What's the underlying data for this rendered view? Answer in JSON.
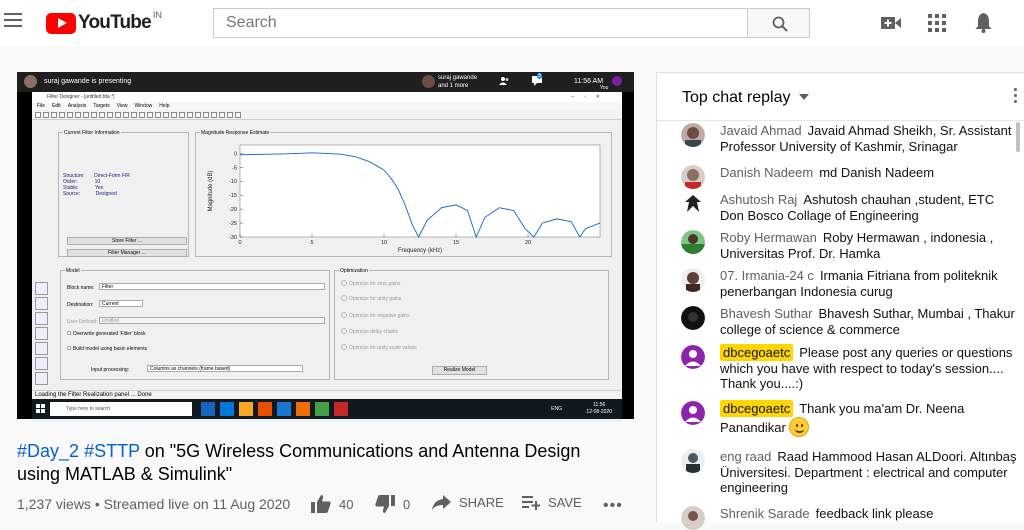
{
  "header": {
    "logo_text": "YouTube",
    "country": "IN",
    "search_placeholder": "Search"
  },
  "player": {
    "presenter_text": "suraj gawande is presenting",
    "participants_line1": "suraj gawande",
    "participants_line2": "and 1 more",
    "participant_count": "3",
    "meet_time": "11:56 AM",
    "you_label": "You",
    "app": {
      "window_title": "Filter Designer - [untitled.fda *]",
      "menu": [
        "File",
        "Edit",
        "Analysis",
        "Targets",
        "View",
        "Window",
        "Help"
      ],
      "current_filter_label": "Current Filter Information",
      "structure_label": "Structure:",
      "structure_value": "Direct-Form FIR",
      "order_label": "Order:",
      "order_value": "10",
      "stable_label": "Stable:",
      "stable_value": "Yes",
      "source_label": "Source:",
      "source_value": "Designed",
      "store_filter": "Store Filter ...",
      "filter_manager": "Filter Manager ...",
      "magnitude_panel_label": "Magnitude Response Estimate",
      "plot_ylabel": "Magnitude (dB)",
      "plot_xlabel": "Frequency (kHz)",
      "model_label": "Model",
      "block_name_label": "Block name:",
      "block_name_value": "Filter",
      "destination_label": "Destination:",
      "destination_value": "Current",
      "user_defined_label": "User Defined:",
      "user_defined_value": "Untitled",
      "overwrite_label": "Overwrite generated 'Filter' block",
      "build_model_label": "Build model using basic elements",
      "input_processing_label": "Input processing:",
      "input_processing_value": "Columns as channels (frame based)",
      "optimization_label": "Optimization",
      "opt1": "Optimize for zero gains",
      "opt2": "Optimize for unity gains",
      "opt3": "Optimize for negative gains",
      "opt4": "Optimize delay chains",
      "opt5": "Optimize for unity scale values",
      "realize_model": "Realize Model",
      "status": "Loading the Filter Realization panel ... Done",
      "taskbar_search": "Type here to search",
      "tray_lang": "ENG",
      "clock_time": "11:56",
      "clock_date": "12-08-2020"
    }
  },
  "chart_data": {
    "type": "line",
    "ylabel": "Magnitude (dB)",
    "xlabel": "Frequency (kHz)",
    "xlim": [
      0,
      25
    ],
    "ylim": [
      -30,
      3
    ],
    "x_ticks": [
      0,
      5,
      10,
      15,
      20
    ],
    "y_ticks": [
      0,
      -5,
      -10,
      -15,
      -20,
      -25,
      -30
    ],
    "series": [
      {
        "x": [
          0,
          1,
          2,
          3,
          4,
          5,
          6,
          7,
          8,
          9,
          10,
          10.5,
          11,
          11.5,
          12,
          12.4,
          13,
          14,
          15,
          15.8,
          16.4,
          17,
          18,
          19,
          19.8,
          20.4,
          21,
          22,
          23,
          23.6,
          24,
          25
        ],
        "y": [
          -0.5,
          -0.4,
          -0.3,
          -0.2,
          0,
          0.2,
          0,
          -0.3,
          -1.2,
          -3,
          -6,
          -9,
          -13,
          -19,
          -26,
          -30,
          -24,
          -19.5,
          -18.5,
          -20.5,
          -30,
          -23,
          -19.5,
          -20.5,
          -27,
          -30,
          -25,
          -23.5,
          -24.5,
          -30,
          -27,
          -25
        ]
      }
    ]
  },
  "video": {
    "title_tag1": "#Day_2",
    "title_tag2": "#STTP",
    "title_rest": " on \"5G Wireless Communications and Antenna Design using MATLAB & Simulink\"",
    "meta": "1,237 views • Streamed live on 11 Aug 2020",
    "likes": "40",
    "dislikes": "0",
    "share": "SHARE",
    "save": "SAVE"
  },
  "chat": {
    "title": "Top chat replay",
    "messages": [
      {
        "author": "Javaid Ahmad",
        "text": "Javaid Ahmad Sheikh, Sr. Assistant Professor University of Kashmir, Srinagar",
        "avatar_color": "#6d4c41"
      },
      {
        "author": "Danish Nadeem",
        "text": "md Danish Nadeem",
        "avatar_color": "#a1887f"
      },
      {
        "author": "Ashutosh Raj",
        "text": "Ashutosh chauhan ,student, ETC Don Bosco Collage of Engineering",
        "avatar_color": "#ffffff"
      },
      {
        "author": "Roby Hermawan",
        "text": "Roby Hermawan , indonesia , Universitas Prof. Dr. Hamka",
        "avatar_color": "#4e7d5a"
      },
      {
        "author": "07. Irmania-24 c",
        "text": "Irmania Fitriana from politeknik penerbangan Indonesia curug",
        "avatar_color": "#5d4037"
      },
      {
        "author": "Bhavesh Suthar",
        "text": "Bhavesh Suthar, Mumbai , Thakur college of science & commerce",
        "avatar_color": "#111111"
      },
      {
        "author": "dbcegoaetc",
        "text": "Please post any queries or questions which you have with respect to today's session.... Thank you....:)",
        "avatar_color": "#8e24aa"
      },
      {
        "author": "dbcegoaetc",
        "text": "Thank you ma'am Dr. Neena Panandikar",
        "avatar_color": "#8e24aa"
      },
      {
        "author": "eng raad",
        "text": "Raad Hammood Hasan ALDoori. Altınbaş Üniversitesi. Department : electrical and computer engineering",
        "avatar_color": "#455a64"
      },
      {
        "author": "Shrenik Sarade",
        "text": "feedback link please",
        "avatar_color": "#795548"
      }
    ]
  }
}
